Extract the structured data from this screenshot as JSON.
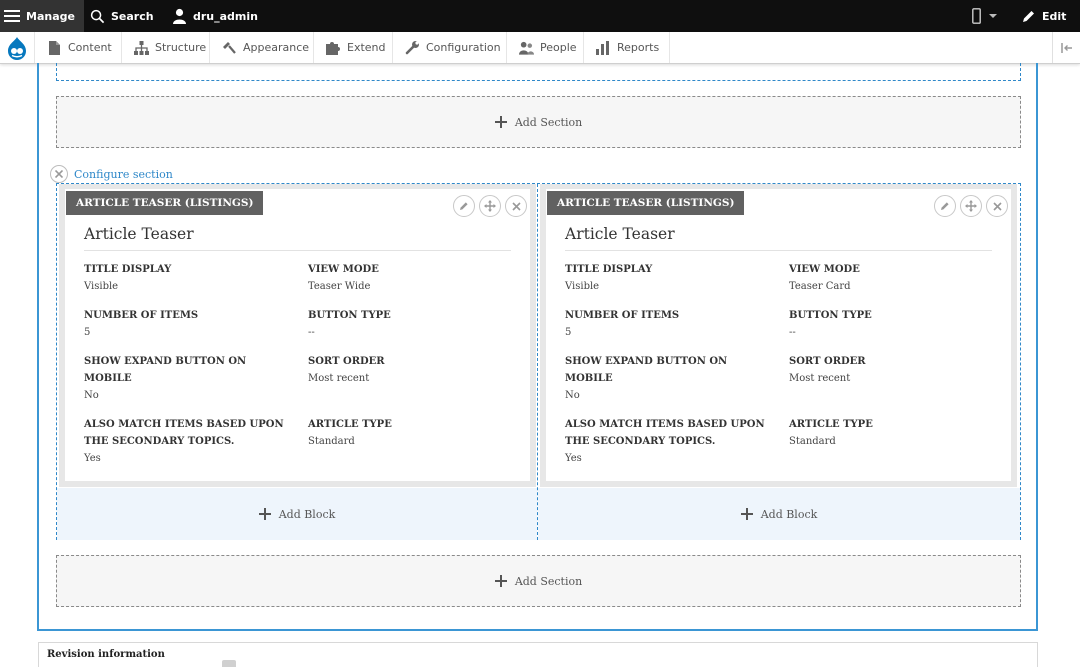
{
  "toolbar": {
    "manage_label": "Manage",
    "search_label": "Search",
    "user_label": "dru_admin",
    "edit_label": "Edit"
  },
  "admin_menu": {
    "items": [
      {
        "label": "Content",
        "icon": "page-icon"
      },
      {
        "label": "Structure",
        "icon": "sitemap-icon"
      },
      {
        "label": "Appearance",
        "icon": "brush-icon"
      },
      {
        "label": "Extend",
        "icon": "puzzle-icon"
      },
      {
        "label": "Configuration",
        "icon": "wrench-icon"
      },
      {
        "label": "People",
        "icon": "people-icon"
      },
      {
        "label": "Reports",
        "icon": "bar-chart-icon"
      }
    ]
  },
  "layout": {
    "add_section_label": "Add Section",
    "configure_section_label": "Configure section",
    "add_block_label": "Add Block",
    "blocks": [
      {
        "label": "ARTICLE TEASER (LISTINGS)",
        "title": "Article Teaser",
        "fields": [
          {
            "label": "TITLE DISPLAY",
            "value": "Visible"
          },
          {
            "label": "VIEW MODE",
            "value": "Teaser Wide"
          },
          {
            "label": "NUMBER OF ITEMS",
            "value": "5"
          },
          {
            "label": "BUTTON TYPE",
            "value": "--"
          },
          {
            "label": "SHOW EXPAND BUTTON ON MOBILE",
            "value": "No"
          },
          {
            "label": "SORT ORDER",
            "value": "Most recent"
          },
          {
            "label": "ALSO MATCH ITEMS BASED UPON THE SECONDARY TOPICS.",
            "value": "Yes"
          },
          {
            "label": "ARTICLE TYPE",
            "value": "Standard"
          }
        ]
      },
      {
        "label": "ARTICLE TEASER (LISTINGS)",
        "title": "Article Teaser",
        "fields": [
          {
            "label": "TITLE DISPLAY",
            "value": "Visible"
          },
          {
            "label": "VIEW MODE",
            "value": "Teaser Card"
          },
          {
            "label": "NUMBER OF ITEMS",
            "value": "5"
          },
          {
            "label": "BUTTON TYPE",
            "value": "--"
          },
          {
            "label": "SHOW EXPAND BUTTON ON MOBILE",
            "value": "No"
          },
          {
            "label": "SORT ORDER",
            "value": "Most recent"
          },
          {
            "label": "ALSO MATCH ITEMS BASED UPON THE SECONDARY TOPICS.",
            "value": "Yes"
          },
          {
            "label": "ARTICLE TYPE",
            "value": "Standard"
          }
        ]
      }
    ]
  },
  "revision": {
    "title": "Revision information"
  },
  "colors": {
    "toolbar_bg": "#0f0f0f",
    "accent_blue": "#2f88c9",
    "drupal_blue": "#0678be",
    "block_label_bg": "#616161"
  }
}
